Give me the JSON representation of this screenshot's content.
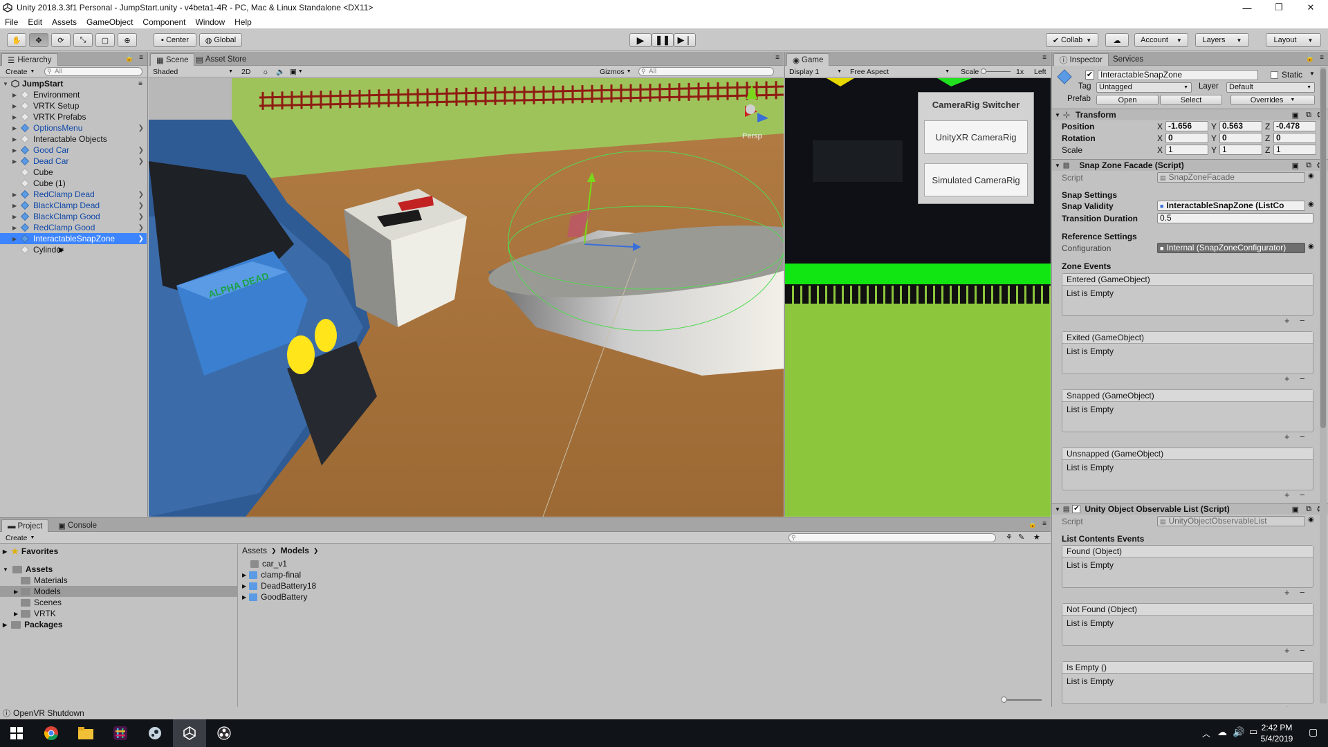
{
  "window": {
    "title": "Unity 2018.3.3f1 Personal - JumpStart.unity - v4beta1-4R - PC, Mac & Linux Standalone <DX11>",
    "minimize": "—",
    "maximize": "❐",
    "close": "✕"
  },
  "menu": [
    "File",
    "Edit",
    "Assets",
    "GameObject",
    "Component",
    "Window",
    "Help"
  ],
  "toolbar": {
    "pivot": "Center",
    "space": "Global",
    "collab": "Collab",
    "account": "Account",
    "layers": "Layers",
    "layout": "Layout"
  },
  "hierarchy": {
    "tab": "Hierarchy",
    "create": "Create",
    "search_placeholder": "All",
    "scene": "JumpStart",
    "items": [
      {
        "label": "Environment",
        "prefab": false
      },
      {
        "label": "VRTK Setup",
        "prefab": false
      },
      {
        "label": "VRTK Prefabs",
        "prefab": false
      },
      {
        "label": "OptionsMenu",
        "prefab": true
      },
      {
        "label": "Interactable Objects",
        "prefab": false
      },
      {
        "label": "Good Car",
        "prefab": true
      },
      {
        "label": "Dead Car",
        "prefab": true
      },
      {
        "label": "Cube",
        "prefab": false
      },
      {
        "label": "Cube (1)",
        "prefab": false
      },
      {
        "label": "RedClamp Dead",
        "prefab": true
      },
      {
        "label": "BlackClamp Dead",
        "prefab": true
      },
      {
        "label": "BlackClamp Good",
        "prefab": true
      },
      {
        "label": "RedClamp Good",
        "prefab": true
      },
      {
        "label": "InteractableSnapZone",
        "prefab": true,
        "selected": true
      },
      {
        "label": "Cylinder",
        "prefab": false
      }
    ]
  },
  "scene": {
    "tabs": [
      "Scene",
      "Asset Store"
    ],
    "shading": "Shaded",
    "mode2d": "2D",
    "gizmos": "Gizmos",
    "search_placeholder": "All",
    "persp": "Persp",
    "battery_text": "ALPHA DEAD"
  },
  "game": {
    "tab": "Game",
    "display": "Display 1",
    "aspect": "Free Aspect",
    "scale_label": "Scale",
    "scale_value": "1x",
    "right_label": "Left",
    "switcher": {
      "title": "CameraRig Switcher",
      "buttons": [
        "UnityXR CameraRig",
        "Simulated CameraRig"
      ]
    }
  },
  "inspector": {
    "tabs": [
      "Inspector",
      "Services"
    ],
    "object_name": "InteractableSnapZone",
    "static_label": "Static",
    "tag_label": "Tag",
    "tag_value": "Untagged",
    "layer_label": "Layer",
    "layer_value": "Default",
    "prefab_label": "Prefab",
    "prefab_open": "Open",
    "prefab_select": "Select",
    "prefab_overrides": "Overrides",
    "transform": {
      "title": "Transform",
      "rows": [
        {
          "label": "Position",
          "x": "-1.656",
          "y": "0.563",
          "z": "-0.478"
        },
        {
          "label": "Rotation",
          "x": "0",
          "y": "0",
          "z": "0"
        },
        {
          "label": "Scale",
          "x": "1",
          "y": "1",
          "z": "1"
        }
      ]
    },
    "facade": {
      "title": "Snap Zone Facade (Script)",
      "script_label": "Script",
      "script_value": "SnapZoneFacade",
      "snap_settings": "Snap Settings",
      "validity_label": "Snap Validity",
      "validity_value": "InteractableSnapZone (ListCo",
      "duration_label": "Transition Duration",
      "duration_value": "0.5",
      "reference_settings": "Reference Settings",
      "config_label": "Configuration",
      "config_value": "Internal (SnapZoneConfigurator)",
      "zone_events": "Zone Events",
      "events": [
        {
          "title": "Entered (GameObject)",
          "body": "List is Empty"
        },
        {
          "title": "Exited (GameObject)",
          "body": "List is Empty"
        },
        {
          "title": "Snapped (GameObject)",
          "body": "List is Empty"
        },
        {
          "title": "Unsnapped (GameObject)",
          "body": "List is Empty"
        }
      ]
    },
    "observable": {
      "title": "Unity Object Observable List (Script)",
      "script_label": "Script",
      "script_value": "UnityObjectObservableList",
      "section": "List Contents Events",
      "events": [
        {
          "title": "Found (Object)",
          "body": "List is Empty"
        },
        {
          "title": "Not Found (Object)",
          "body": "List is Empty"
        },
        {
          "title": "Is Empty ()",
          "body": "List is Empty"
        }
      ]
    },
    "plus": "+",
    "minus": "−"
  },
  "project": {
    "tabs": [
      "Project",
      "Console"
    ],
    "create": "Create",
    "favorites": "Favorites",
    "assets": "Assets",
    "asset_folders": [
      "Materials",
      "Models",
      "Scenes",
      "VRTK"
    ],
    "packages": "Packages",
    "breadcrumb": [
      "Assets",
      "Models"
    ],
    "files": [
      {
        "label": "car_v1",
        "type": "folder"
      },
      {
        "label": "clamp-final",
        "type": "model"
      },
      {
        "label": "DeadBattery18",
        "type": "model"
      },
      {
        "label": "GoodBattery",
        "type": "model"
      }
    ]
  },
  "status": {
    "text": "OpenVR Shutdown"
  },
  "taskbar": {
    "time": "2:42 PM",
    "date": "5/4/2019"
  },
  "colors": {
    "selection": "#3d85ff",
    "prefab_blue": "#1047a8",
    "panel": "#c2c2c2"
  }
}
